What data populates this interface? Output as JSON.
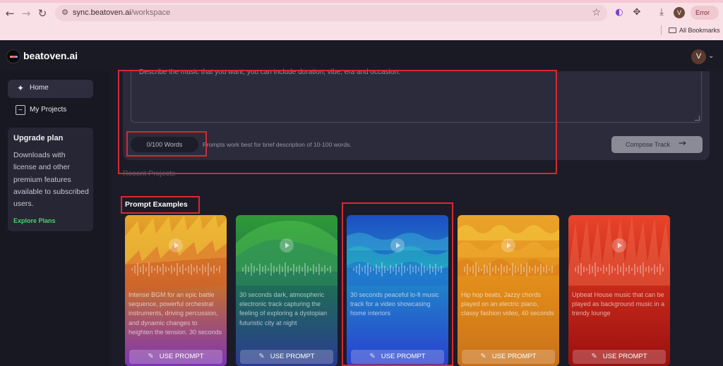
{
  "browser": {
    "url_host": "sync.beatoven.ai",
    "url_path": "/workspace",
    "profile_initial": "V",
    "error_label": "Error",
    "bookmarks_label": "All Bookmarks"
  },
  "app": {
    "brand": "beatoven.ai",
    "avatar_initial": "V"
  },
  "sidebar": {
    "items": [
      {
        "label": "Home",
        "icon": "sparkle-icon"
      },
      {
        "label": "My Projects",
        "icon": "waveform-box-icon"
      }
    ],
    "upgrade": {
      "title": "Upgrade plan",
      "description": "Downloads with license and other premium features available to subscribed users.",
      "link": "Explore Plans"
    }
  },
  "composer": {
    "placeholder": "Describe the music that you want, you can include duration, vibe, era and occasion.",
    "word_count": "0/100 Words",
    "tip": "Prompts work best for brief description of 10-100 words.",
    "compose_label": "Compose Track"
  },
  "recent_projects_label": "Recent Projects",
  "prompt_examples_label": "Prompt Examples",
  "cards": [
    {
      "text": "Intense BGM for an epic battle sequence, powerful orchestral instruments, driving percussion, and dynamic changes to heighten the tension. 30 seconds",
      "button": "USE PROMPT",
      "colors": [
        "#e0a12a",
        "#8f3fb8"
      ]
    },
    {
      "text": "30 seconds dark, atmospheric electronic track capturing the feeling of exploring a dystopian futuristic city at night",
      "button": "USE PROMPT",
      "colors": [
        "#2d8f3a",
        "#253a8e"
      ]
    },
    {
      "text": "30 seconds peaceful lo-fi music track for a video showcasing home interiors",
      "button": "USE PROMPT",
      "colors": [
        "#1f5fc8",
        "#2a44d0"
      ]
    },
    {
      "text": "Hip hop beats, Jazzy chords played on an electric piano, classy fashion video, 40 seconds",
      "button": "USE PROMPT",
      "colors": [
        "#e8a21a",
        "#d0761a"
      ]
    },
    {
      "text": "Upbeat House music that can be played as background music in a trendy lounge",
      "button": "USE PROMPT",
      "colors": [
        "#e8402a",
        "#9a1010"
      ]
    }
  ]
}
